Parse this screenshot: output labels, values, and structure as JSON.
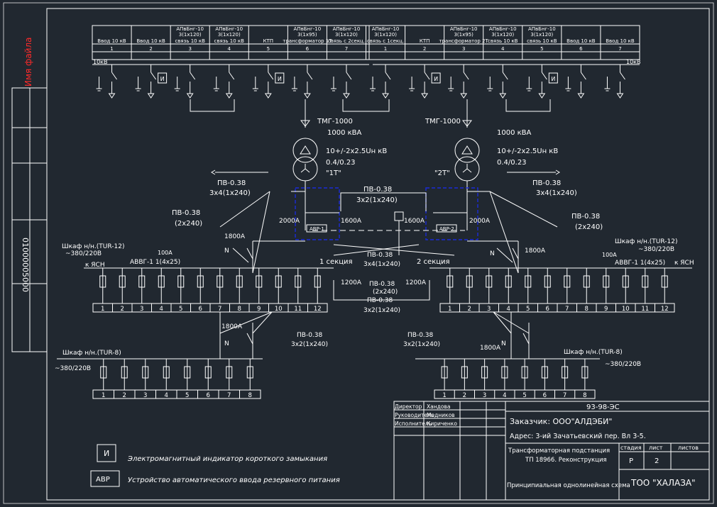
{
  "stamp_left": {
    "name_red": "Имя файла",
    "code": "01000005000"
  },
  "switchgear_panels": [
    {
      "num": "1",
      "name": "Ввод 10 кВ",
      "cable": ""
    },
    {
      "num": "2",
      "name": "Ввод 10 кВ",
      "cable": ""
    },
    {
      "num": "3",
      "name": "связь 10 кВ",
      "cable": "АПвБнг-10\n3(1х120)"
    },
    {
      "num": "4",
      "name": "связь 10 кВ",
      "cable": "АПвБнг-10\n3(1х120)"
    },
    {
      "num": "5",
      "name": "КТП",
      "cable": ""
    },
    {
      "num": "6",
      "name": "трансформатор 1Т",
      "cable": "АПвБнг-10\n3(1х95)"
    },
    {
      "num": "7",
      "name": "связь с 2секц.",
      "cable": "АПвБнг-10\n3(1х120)"
    },
    {
      "num": "1",
      "name": "связь с 1секц.",
      "cable": "АПвБнг-10\n3(1х120)"
    },
    {
      "num": "2",
      "name": "КТП",
      "cable": ""
    },
    {
      "num": "3",
      "name": "трансформатор 2Т",
      "cable": "АПвБнг-10\n3(1х95)"
    },
    {
      "num": "4",
      "name": "связь 10 кВ",
      "cable": "АПвБнг-10\n3(1х120)"
    },
    {
      "num": "5",
      "name": "связь 10 кВ",
      "cable": "АПвБнг-10\n3(1х120)"
    },
    {
      "num": "6",
      "name": "Ввод 10 кВ",
      "cable": ""
    },
    {
      "num": "7",
      "name": "Ввод 10 кВ",
      "cable": ""
    }
  ],
  "bus_label_left": "10кВ",
  "bus_label_right": "10кВ",
  "indicator_letter": "И",
  "transformer_1": {
    "type": "ТМГ-1000",
    "power": "1000 кВА",
    "tap": "10+/-2х2.5Uн кВ",
    "ratio": "0.4/0.23",
    "name": "\"1Т\""
  },
  "transformer_2": {
    "type": "ТМГ-1000",
    "power": "1000 кВА",
    "tap": "10+/-2х2.5Uн кВ",
    "ratio": "0.4/0.23",
    "name": "\"2Т\""
  },
  "cables": {
    "pv_left_top": "ПВ-0.38",
    "pv_left_top_spec": "3х4(1х240)",
    "pv_right_top": "ПВ-0.38",
    "pv_right_top_spec": "3х4(1х240)",
    "pv_mid": "ПВ-0.38",
    "pv_mid_spec": "3х2(1х240)",
    "pv_left_side": "ПВ-0.38",
    "pv_left_side_spec": "(2х240)",
    "pv_right_side": "ПВ-0.38",
    "pv_right_side_spec": "(2х240)",
    "pv_bus": "ПВ-0.38",
    "pv_bus_spec": "3х4(1х240)",
    "pv_low_a": "ПВ-0.38",
    "pv_low_a_spec": "(2х240)",
    "pv_low_b": "ПВ-0.38",
    "pv_low_b_spec": "3х2(1х240)",
    "pv_left_bottom": "ПВ-0.38",
    "pv_left_bottom_spec": "3х2(1х240)",
    "pv_right_bottom": "ПВ-0.38",
    "pv_right_bottom_spec": "3х2(1х240)"
  },
  "breakers": {
    "b2000a_left": "2000А",
    "b1600a_left": "1600А",
    "b1600a_right": "1600А",
    "b2000a_right": "2000А",
    "b1800_l": "1800А",
    "b1800_r": "1800А",
    "b1200_l": "1200А",
    "b1200_r": "1200А",
    "b1800_lb": "1800А",
    "b1800_rb": "1800А",
    "b100_l": "100А",
    "b100_r": "100А",
    "n": "N"
  },
  "avr_1": "АВР-1",
  "avr_2": "АВР-2",
  "section_1": "1 секция",
  "section_2": "2 секция",
  "cabinet_left": {
    "title": "Шкаф н/н.(TUR-12)",
    "voltage": "~380/220В",
    "cable": "АВВГ-1 1(4х25)",
    "to": "к ЯСН"
  },
  "cabinet_right": {
    "title": "Шкаф н/н.(TUR-12)",
    "voltage": "~380/220В",
    "cable": "АВВГ-1 1(4х25)",
    "to": "к ЯСН"
  },
  "cabinet_left_bottom": {
    "title": "Шкаф н/н.(TUR-8)",
    "voltage": "~380/220В"
  },
  "cabinet_right_bottom": {
    "title": "Шкаф н/н.(TUR-8)",
    "voltage": "~380/220В"
  },
  "feeders_12": [
    "1",
    "2",
    "3",
    "4",
    "5",
    "6",
    "7",
    "8",
    "9",
    "10",
    "11",
    "12"
  ],
  "feeders_8": [
    "1",
    "2",
    "3",
    "4",
    "5",
    "6",
    "7",
    "8"
  ],
  "legend": [
    {
      "symbol": "И",
      "text": "Электромагнитный индикатор короткого замыкания"
    },
    {
      "symbol": "АВР",
      "text": "Устройство автоматического ввода резервного питания"
    }
  ],
  "title_block": {
    "doc_code": "93-98-ЭС",
    "customer": "Заказчик: ООО\"АЛДЭБИ\"",
    "address": "Адрес:  3-ий Зачатьевский пер. Вл 3-5.",
    "object_l1": "Трансформаторная подстанция",
    "object_l2": "ТП 18966. Реконструкция",
    "sheet_title": "Принципиальная однолинейная схема",
    "company": "ТОО \"ХАЛАЗА\"",
    "stage_h": "стадия",
    "sheet_h": "лист",
    "sheets_h": "листов",
    "stage": "Р",
    "sheet": "2",
    "sheets": "",
    "roles": [
      {
        "role": "Директор",
        "name": "Хандова"
      },
      {
        "role": "Руководитель",
        "name": "Медников"
      },
      {
        "role": "Исполнитель",
        "name": "Кириченко"
      }
    ]
  }
}
